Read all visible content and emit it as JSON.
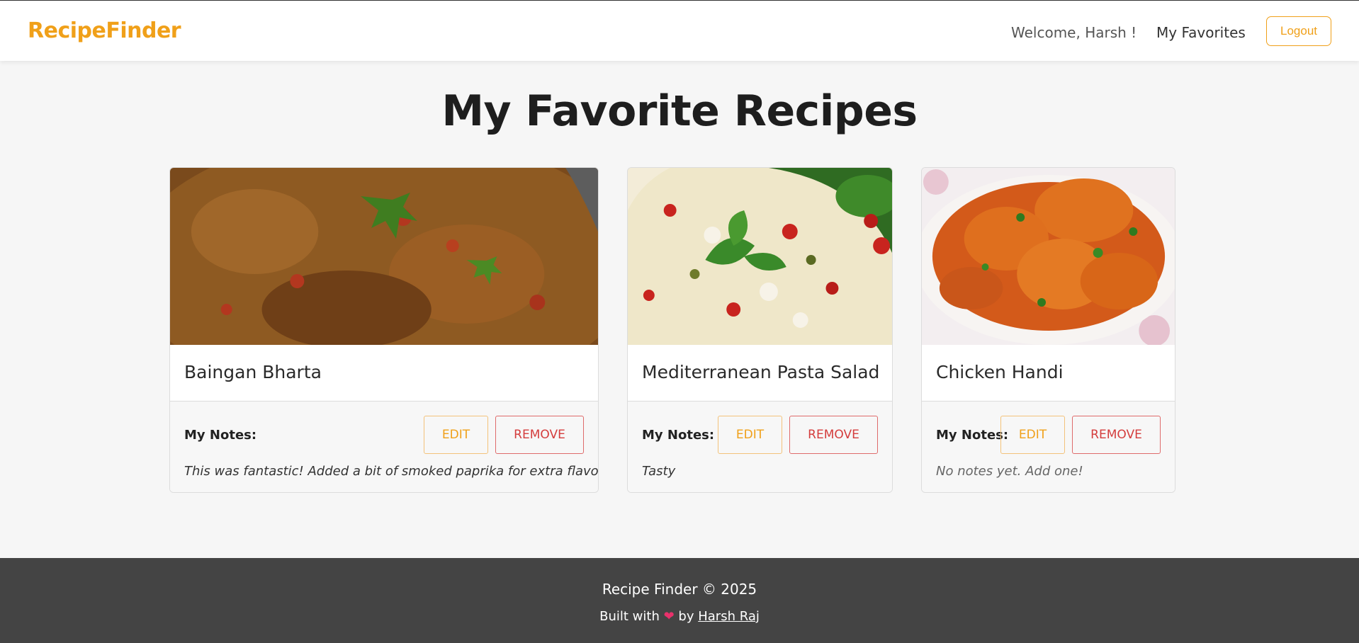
{
  "navbar": {
    "brand": "RecipeFinder",
    "welcome": "Welcome, Harsh !",
    "favorites_link": "My Favorites",
    "logout_label": "Logout",
    "accent_color": "#f0a019"
  },
  "page": {
    "title": "My Favorite Recipes"
  },
  "cards": [
    {
      "title": "Baingan Bharta",
      "notes_label": "My Notes:",
      "edit_label": "EDIT",
      "remove_label": "REMOVE",
      "note": "This was fantastic! Added a bit of smoked paprika for extra flavor."
    },
    {
      "title": "Mediterranean Pasta Salad",
      "notes_label": "My Notes:",
      "edit_label": "EDIT",
      "remove_label": "REMOVE",
      "note": "Tasty"
    },
    {
      "title": "Chicken Handi",
      "notes_label": "My Notes:",
      "edit_label": "EDIT",
      "remove_label": "REMOVE",
      "note": "No notes yet. Add one!"
    }
  ],
  "footer": {
    "copyright": "Recipe Finder © 2025",
    "built_with": "Built with",
    "heart": "❤",
    "by": "by",
    "author": "Harsh Raj"
  }
}
